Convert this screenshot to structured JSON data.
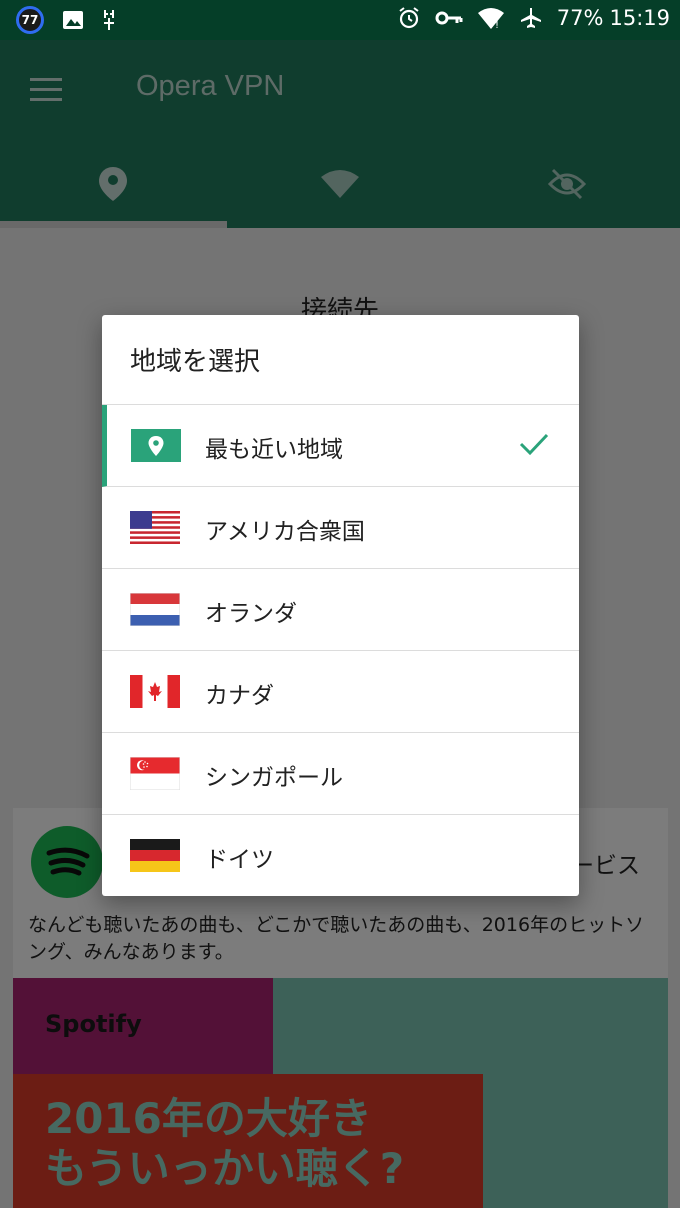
{
  "status_bar": {
    "notification_badge": "77",
    "battery": "77%",
    "time": "15:19"
  },
  "app_bar": {
    "title": "Opera VPN",
    "tabs": [
      {
        "icon": "location-pin-icon",
        "active": true
      },
      {
        "icon": "wifi-icon",
        "active": false
      },
      {
        "icon": "eye-off-icon",
        "active": false
      }
    ]
  },
  "background": {
    "heading": "接続先",
    "ad": {
      "title_fragment": "ービス",
      "description": "なんども聴いたあの曲も、どこかで聴いたあの曲も、2016年のヒットソング、みんなあります。",
      "brand": "Spotify",
      "headline_line1": "2016年の大好き",
      "headline_line2": "もういっかい聴く?"
    }
  },
  "dialog": {
    "title": "地域を選択",
    "items": [
      {
        "label": "最も近い地域",
        "flag": "nearest",
        "selected": true
      },
      {
        "label": "アメリカ合衆国",
        "flag": "us",
        "selected": false
      },
      {
        "label": "オランダ",
        "flag": "nl",
        "selected": false
      },
      {
        "label": "カナダ",
        "flag": "ca",
        "selected": false
      },
      {
        "label": "シンガポール",
        "flag": "sg",
        "selected": false
      },
      {
        "label": "ドイツ",
        "flag": "de",
        "selected": false
      }
    ]
  },
  "colors": {
    "status_bar": "#053e28",
    "app_bar": "#207a5c",
    "accent": "#2aa37a"
  }
}
